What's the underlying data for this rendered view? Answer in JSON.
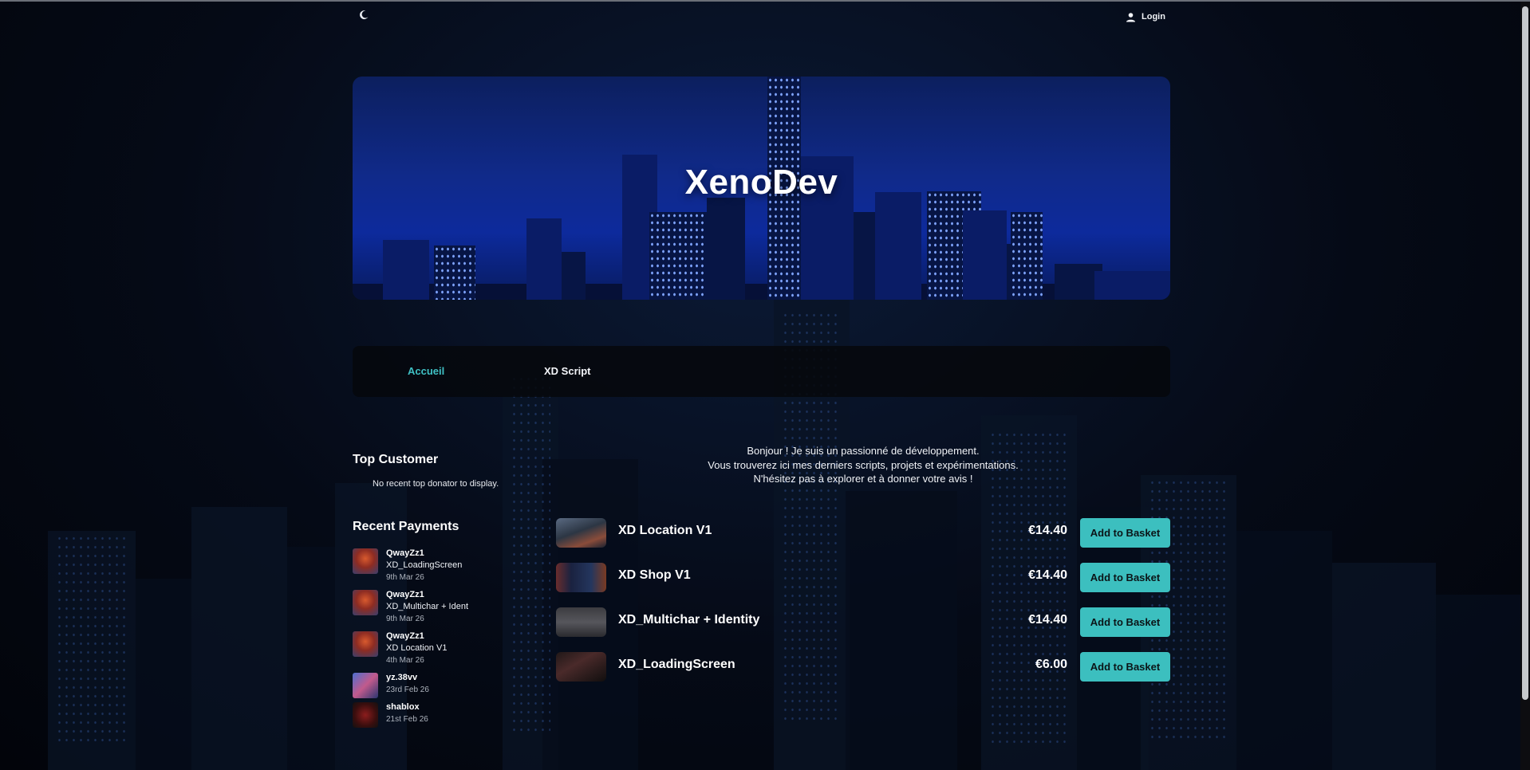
{
  "header": {
    "theme_toggle_icon": "moon-icon",
    "login_label": "Login",
    "login_icon": "user-icon"
  },
  "hero": {
    "title": "XenoDev"
  },
  "nav": {
    "items": [
      {
        "label": "Accueil",
        "active": true
      },
      {
        "label": "XD Script",
        "active": false
      }
    ]
  },
  "sidebar": {
    "top_customer": {
      "heading": "Top Customer",
      "empty_text": "No recent top donator to display."
    },
    "recent_payments": {
      "heading": "Recent Payments",
      "items": [
        {
          "name": "QwayZz1",
          "item": "XD_LoadingScreen",
          "date": "9th Mar 26"
        },
        {
          "name": "QwayZz1",
          "item": "XD_Multichar + Ident",
          "date": "9th Mar 26"
        },
        {
          "name": "QwayZz1",
          "item": "XD Location V1",
          "date": "4th Mar 26"
        },
        {
          "name": "yz.38vv",
          "item": "",
          "date": "23rd Feb 26"
        },
        {
          "name": "shablox",
          "item": "",
          "date": "21st Feb 26"
        }
      ]
    }
  },
  "intro": {
    "line1": "Bonjour ! Je suis un passionné de développement.",
    "line2": "Vous trouverez ici mes derniers scripts, projets et expérimentations.",
    "line3": "N'hésitez pas à explorer et à donner votre avis !"
  },
  "products": [
    {
      "name": "XD Location V1",
      "price": "€14.40",
      "button": "Add to Basket"
    },
    {
      "name": "XD Shop V1",
      "price": "€14.40",
      "button": "Add to Basket"
    },
    {
      "name": "XD_Multichar + Identity",
      "price": "€14.40",
      "button": "Add to Basket"
    },
    {
      "name": "XD_LoadingScreen",
      "price": "€6.00",
      "button": "Add to Basket"
    }
  ],
  "colors": {
    "accent": "#3cbfbf",
    "background": "#03060c",
    "hero_blue": "#102a8a"
  }
}
